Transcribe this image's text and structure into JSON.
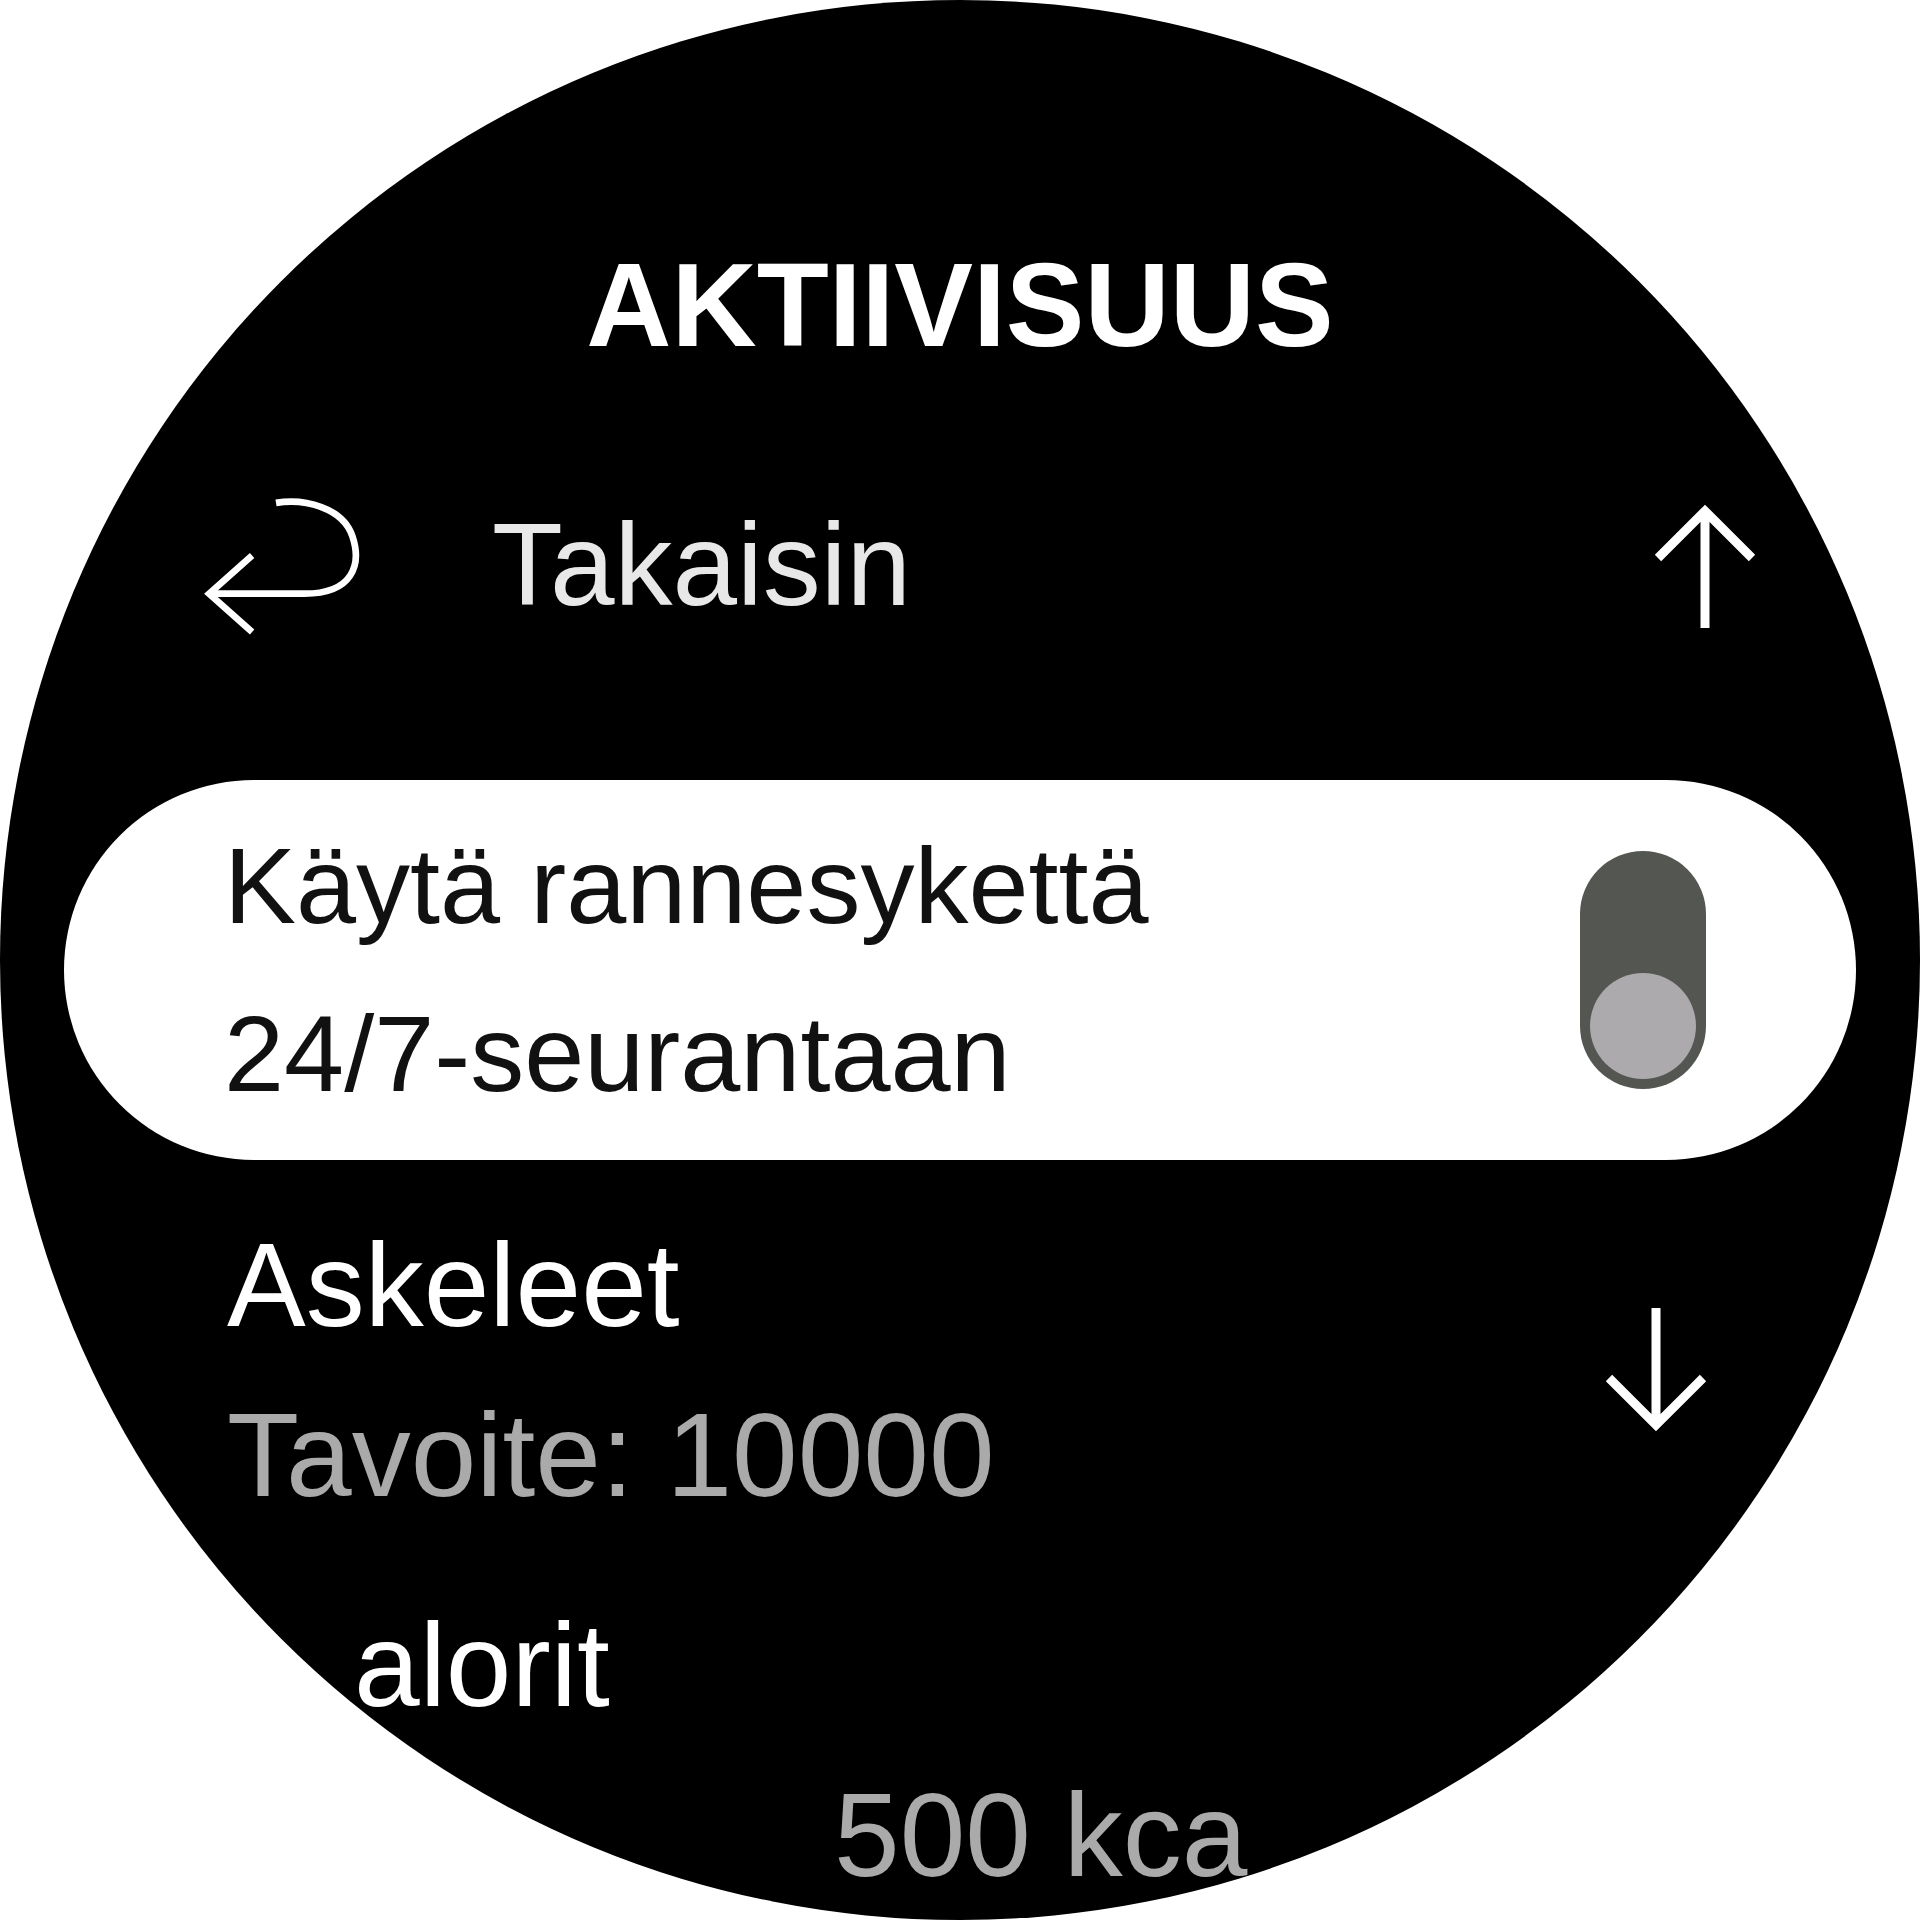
{
  "title": "AKTIIVISUUS",
  "back": {
    "label": "Takaisin"
  },
  "items": [
    {
      "kind": "toggle",
      "lines": [
        "Käytä rannesykettä",
        "24/7-seurantaan"
      ],
      "selected": true,
      "on": false
    },
    {
      "kind": "goal",
      "title": "Askeleet",
      "value": "Tavoite: 10000",
      "selected": false
    },
    {
      "kind": "goal",
      "title": "alorit",
      "value": "500 kca",
      "selected": false
    }
  ]
}
